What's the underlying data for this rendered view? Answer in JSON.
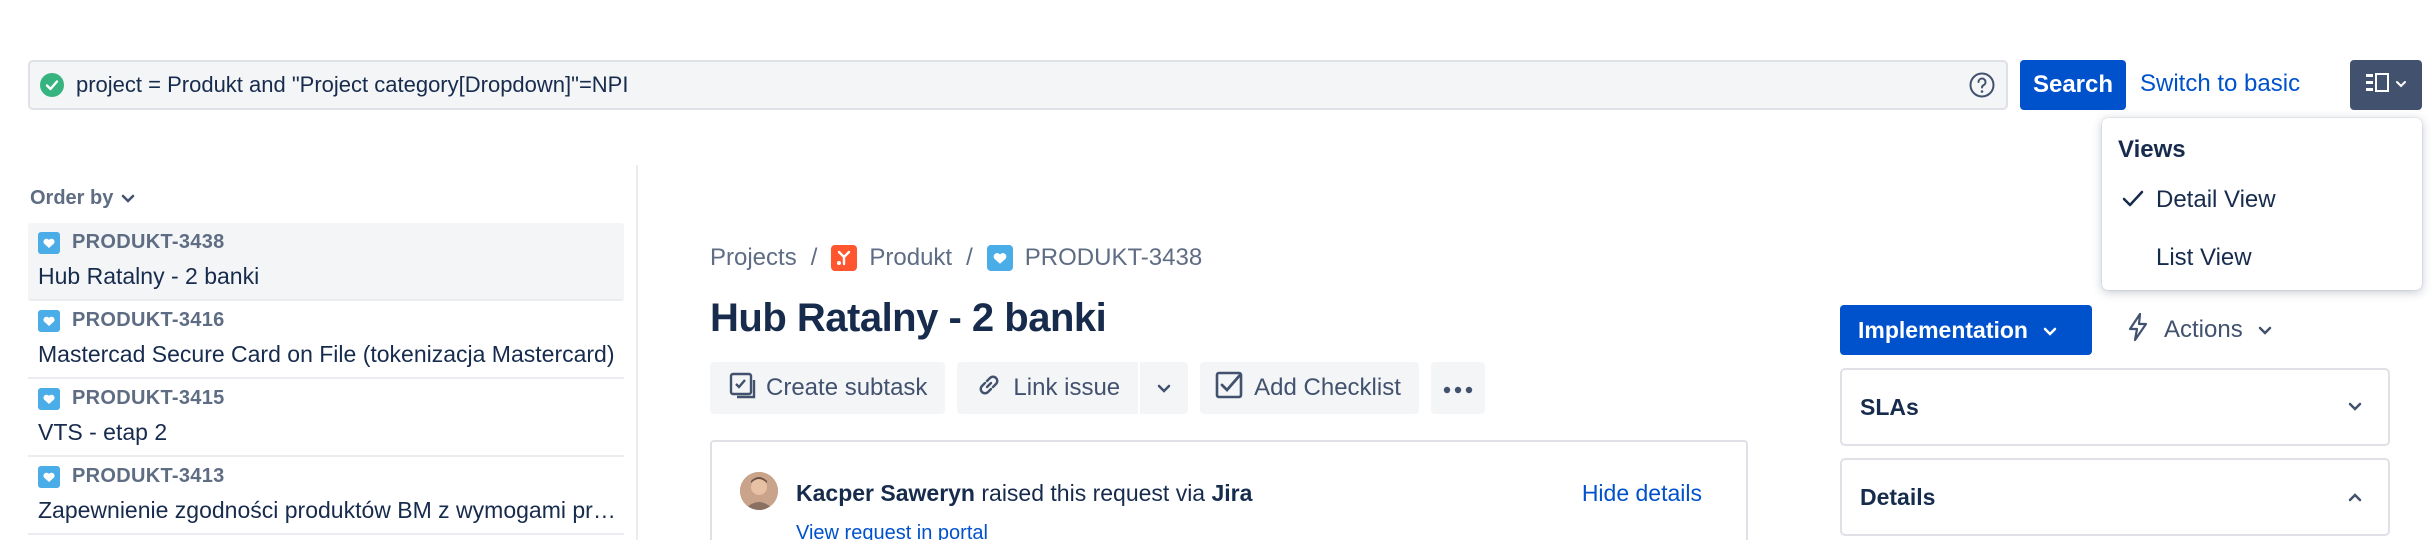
{
  "search": {
    "query": "project = Produkt and \"Project category[Dropdown]\"=NPI",
    "search_label": "Search",
    "switch_label": "Switch to basic"
  },
  "views_menu": {
    "title": "Views",
    "items": [
      {
        "label": "Detail View",
        "selected": true
      },
      {
        "label": "List View",
        "selected": false
      }
    ]
  },
  "issue_list": {
    "order_by_label": "Order by",
    "items": [
      {
        "key": "PRODUKT-3438",
        "summary": "Hub Ratalny - 2 banki",
        "selected": true
      },
      {
        "key": "PRODUKT-3416",
        "summary": "Mastercad Secure Card on File (tokenizacja Mastercard)",
        "selected": false
      },
      {
        "key": "PRODUKT-3415",
        "summary": "VTS - etap 2",
        "selected": false
      },
      {
        "key": "PRODUKT-3413",
        "summary": "Zapewnienie zgodności produktów BM z wymogami prawnymi",
        "selected": false
      }
    ]
  },
  "breadcrumbs": {
    "projects": "Projects",
    "project": "Produkt",
    "issue_key": "PRODUKT-3438"
  },
  "issue": {
    "title": "Hub Ratalny - 2 banki",
    "toolbar": {
      "create_subtask": "Create subtask",
      "link_issue": "Link issue",
      "add_checklist": "Add Checklist"
    },
    "request": {
      "reporter": "Kacper Saweryn",
      "raised_text": "raised this request via",
      "channel": "Jira",
      "hide_details": "Hide details",
      "view_portal": "View request in portal"
    }
  },
  "sidebar": {
    "status_label": "Implementation",
    "actions_label": "Actions",
    "panels": [
      {
        "title": "SLAs",
        "expanded": false
      },
      {
        "title": "Details",
        "expanded": true
      }
    ]
  },
  "colors": {
    "primary": "#0052cc",
    "success": "#36b37e",
    "project_icon": "#ff5630",
    "issue_type": "#4bade8",
    "text": "#172b4d",
    "subtle_text": "#5e6c84"
  }
}
